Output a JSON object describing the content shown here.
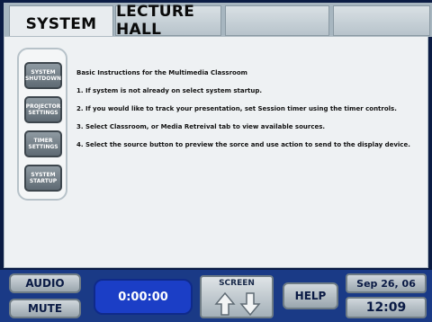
{
  "tabs": [
    {
      "label": "SYSTEM",
      "active": true
    },
    {
      "label": "LECTURE HALL",
      "active": false
    },
    {
      "label": "",
      "active": false
    },
    {
      "label": "",
      "active": false
    }
  ],
  "sidebar": {
    "buttons": [
      {
        "label": "SYSTEM SHUTDOWN"
      },
      {
        "label": "PROJECTOR SETTINGS"
      },
      {
        "label": "TIMER SETTINGS"
      },
      {
        "label": "SYSTEM STARTUP"
      }
    ]
  },
  "instructions": {
    "heading": "Basic Instructions for the Multimedia Classroom",
    "steps": [
      "1. If system is not already on select system startup.",
      "2. If you would like to track your presentation, set Session timer using the timer controls.",
      "3. Select Classroom, or Media Retreival tab to view available sources.",
      "4. Select the source button to preview the sorce and use action to send to the display device."
    ]
  },
  "bottom": {
    "audio_label": "AUDIO",
    "mute_label": "MUTE",
    "timer_value": "0:00:00",
    "screen_label": "SCREEN",
    "screen_up_icon": "arrow-up-icon",
    "screen_down_icon": "arrow-down-icon",
    "help_label": "HELP",
    "date": "Sep 26, 06",
    "time": "12:09"
  }
}
